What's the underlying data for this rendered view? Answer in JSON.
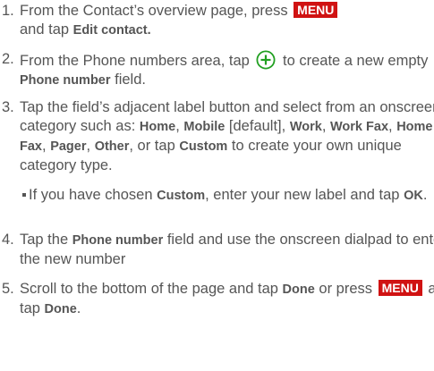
{
  "steps": [
    {
      "number": "1.",
      "text_a": "From the Contact’s overview page, press",
      "key": "MENU",
      "text_b": "and tap",
      "bold_a": "Edit contact."
    },
    {
      "number": "2.",
      "text_a": "From the Phone numbers area, tap",
      "icon": "add-circle-icon",
      "text_b": "to create a new empty",
      "bold_a": "Phone number",
      "text_c": "field."
    },
    {
      "number": "3.",
      "text_a": "Tap the field’s adjacent label button and select from an onscreen category such as:",
      "bold_home": "Home",
      "sep1": ",",
      "bold_mobile": "Mobile",
      "text_default": "[default],",
      "bold_work": "Work",
      "sep2": ",",
      "bold_workfax": "Work Fax",
      "sep3": ",",
      "bold_homefax": "Home Fax",
      "sep4": ",",
      "bold_pager": "Pager",
      "sep5": ",",
      "bold_other": "Other",
      "sep6": ",",
      "text_or": "or tap",
      "bold_custom": "Custom",
      "text_end": "to create your own unique category type."
    },
    {
      "number": "4.",
      "text_a": "Tap the",
      "bold_a": "Phone number",
      "text_b": "field and use the onscreen dialpad to enter the new number"
    },
    {
      "number": "5.",
      "text_a": "Scroll to the bottom of the page and tap",
      "bold_a": "Done",
      "text_b": "or press",
      "key": "MENU",
      "text_c": "and tap",
      "bold_b": "Done",
      "text_d": "."
    }
  ],
  "bullet": {
    "text_a": "If you have chosen",
    "bold_a": "Custom",
    "text_b": ", enter your new label and tap",
    "bold_b": "OK",
    "text_c": "."
  },
  "colors": {
    "text": "#555555",
    "menu_key_bg": "#d01212",
    "plus_icon": "#22a022"
  }
}
